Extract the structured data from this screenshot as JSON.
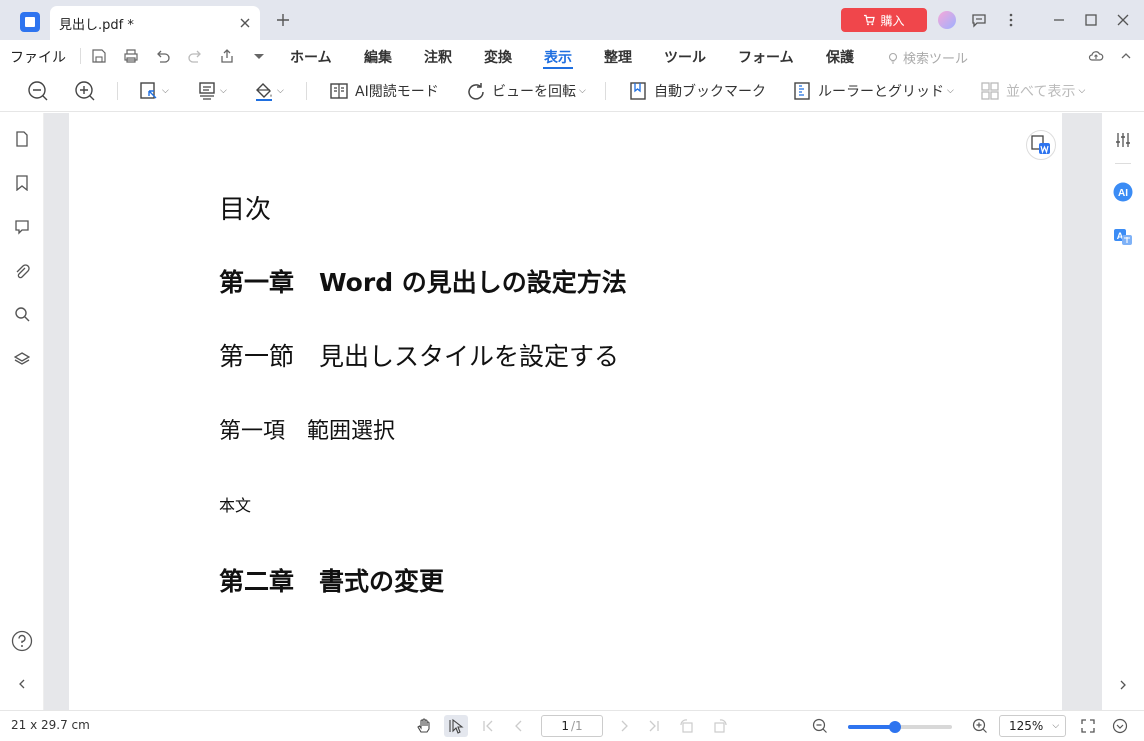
{
  "window": {
    "tab_title": "見出し.pdf *",
    "buy_label": "購入"
  },
  "menu": {
    "file": "ファイル",
    "items": [
      "ホーム",
      "編集",
      "注釈",
      "変換",
      "表示",
      "整理",
      "ツール",
      "フォーム",
      "保護"
    ],
    "active": "表示",
    "search_tools": "検索ツール"
  },
  "toolbar": {
    "ai_reading": "AI閲読モード",
    "rotate_view": "ビューを回転",
    "auto_bookmark": "自動ブックマーク",
    "ruler_grid": "ルーラーとグリッド",
    "side_by_side": "並べて表示"
  },
  "document": {
    "toc": "目次",
    "chapter1": "第一章　Word の見出しの設定方法",
    "section1": "第一節　見出しスタイルを設定する",
    "item1": "第一項　範囲選択",
    "body": "本文",
    "chapter2": "第二章　書式の変更"
  },
  "status": {
    "page_size": "21 x 29.7 cm",
    "current_page": "1",
    "total_pages": "/1",
    "zoom_level": "125%",
    "zoom_slider_fraction": 0.45
  },
  "colors": {
    "accent": "#1f6fe0",
    "buy": "#f0464b",
    "logo": "#2e74ef"
  }
}
